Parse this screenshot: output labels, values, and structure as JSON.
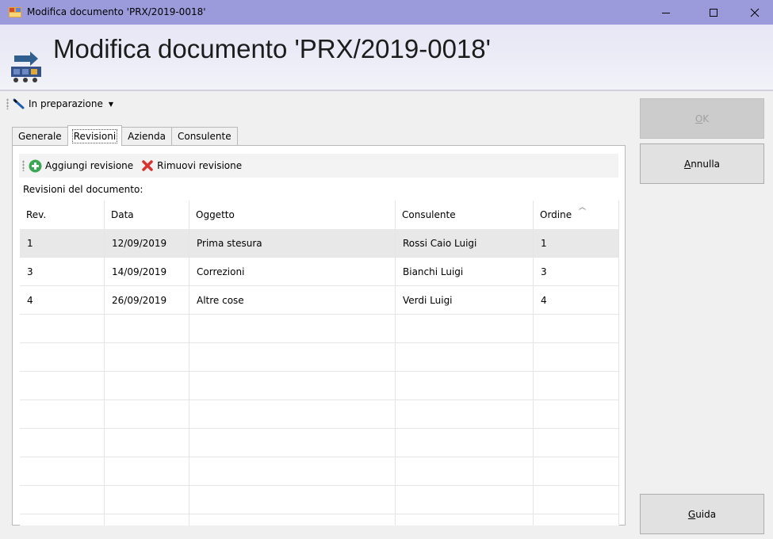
{
  "window": {
    "title": "Modifica documento 'PRX/2019-0018'",
    "minimize_icon": "minimize-icon",
    "maximize_icon": "maximize-icon",
    "close_icon": "close-icon"
  },
  "header": {
    "title": "Modifica documento 'PRX/2019-0018'",
    "icon": "document-edit-icon"
  },
  "status": {
    "label": "In preparazione",
    "icon": "pencil-icon"
  },
  "tabs": [
    {
      "label": "Generale"
    },
    {
      "label": "Revisioni",
      "active": true
    },
    {
      "label": "Azienda"
    },
    {
      "label": "Consulente"
    }
  ],
  "panel": {
    "add_label": "Aggiungi revisione",
    "remove_label": "Rimuovi revisione",
    "caption": "Revisioni del documento:"
  },
  "grid": {
    "columns": [
      "Rev.",
      "Data",
      "Oggetto",
      "Consulente",
      "Ordine"
    ],
    "sort_column": "Ordine",
    "rows": [
      {
        "rev": "1",
        "data": "12/09/2019",
        "oggetto": "Prima stesura",
        "consulente": "Rossi Caio Luigi",
        "ordine": "1"
      },
      {
        "rev": "3",
        "data": "14/09/2019",
        "oggetto": "Correzioni",
        "consulente": "Bianchi Luigi",
        "ordine": "3"
      },
      {
        "rev": "4",
        "data": "26/09/2019",
        "oggetto": "Altre cose",
        "consulente": "Verdi Luigi",
        "ordine": "4"
      }
    ]
  },
  "buttons": {
    "ok": {
      "accel": "O",
      "rest": "K"
    },
    "annulla": {
      "accel": "A",
      "rest": "nnulla"
    },
    "guida": {
      "accel": "G",
      "rest": "uida"
    }
  },
  "colors": {
    "titlebar": "#9b9bdb",
    "add_icon": "#3aa853",
    "remove_icon": "#d9332b"
  }
}
